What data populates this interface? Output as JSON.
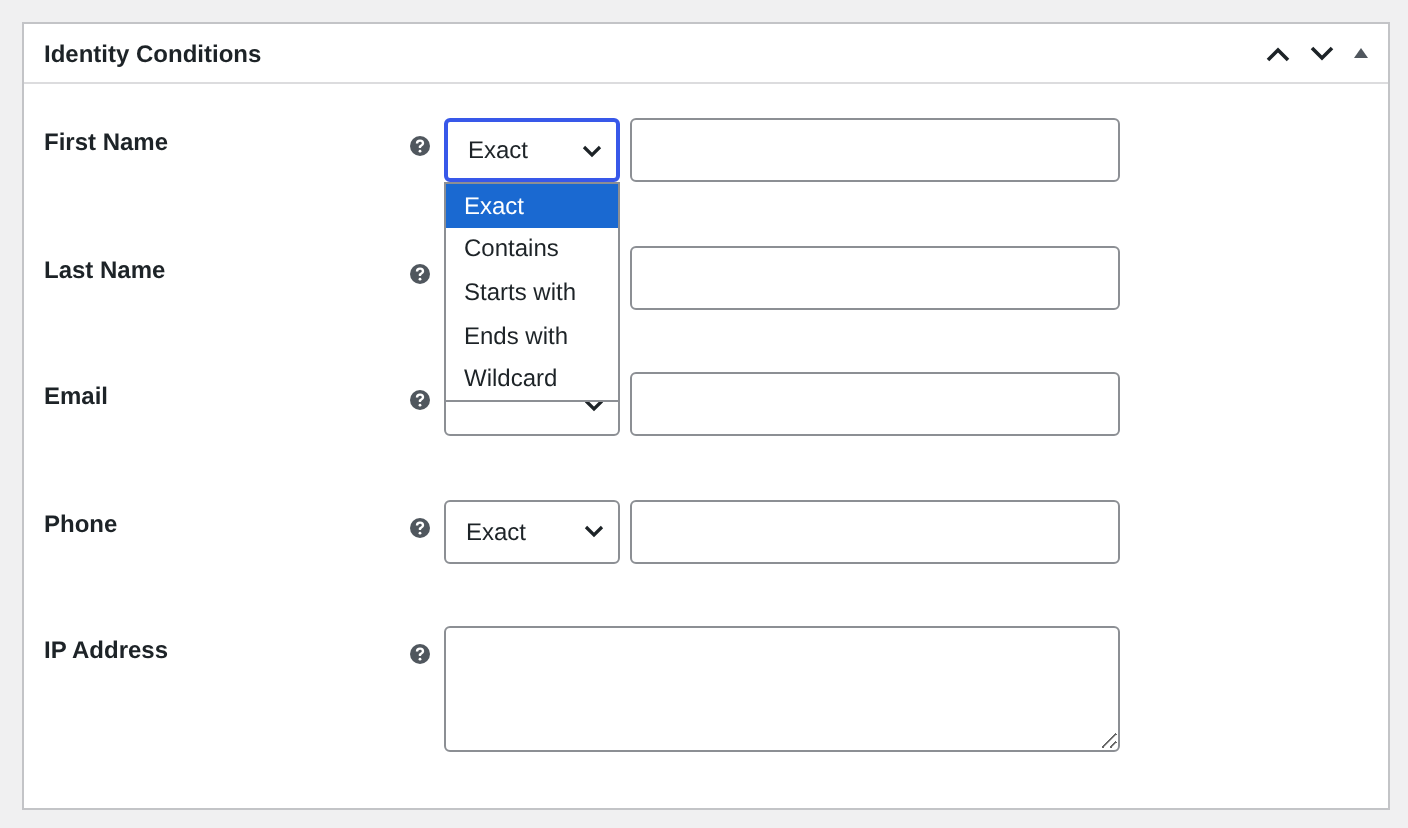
{
  "panel": {
    "title": "Identity Conditions"
  },
  "fields": [
    {
      "label": "First Name",
      "kind": "select_text",
      "select": {
        "value": "Exact",
        "open": true,
        "options": [
          {
            "label": "Exact",
            "selected": true
          },
          {
            "label": "Contains",
            "selected": false
          },
          {
            "label": "Starts with",
            "selected": false
          },
          {
            "label": "Ends with",
            "selected": false
          },
          {
            "label": "Wildcard",
            "selected": false
          }
        ]
      }
    },
    {
      "label": "Last Name",
      "kind": "select_text"
    },
    {
      "label": "Email",
      "kind": "select_text",
      "select": {
        "open": false
      }
    },
    {
      "label": "Phone",
      "kind": "select_text",
      "select": {
        "value": "Exact",
        "open": false
      }
    },
    {
      "label": "IP Address",
      "kind": "textarea"
    }
  ]
}
